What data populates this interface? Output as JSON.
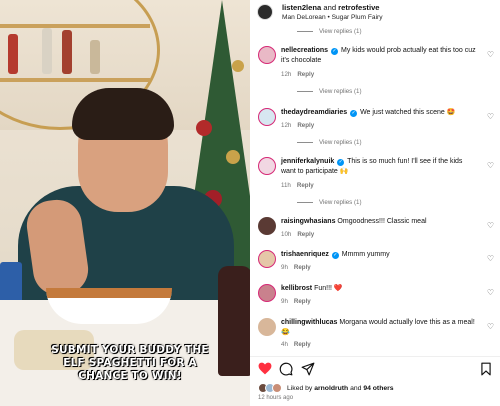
{
  "post": {
    "author_line_user": "listen2lena",
    "author_line_and": " and ",
    "author_line_collab": "retrofestive",
    "audio": "Man DeLorean • Sugar Plum Fairy",
    "caption_overlay": "SUBMIT YOUR BUDDY THE ELF SPAGHETTI FOR A CHANCE TO WIN!"
  },
  "view_replies_label": "View replies (1)",
  "reply_label": "Reply",
  "comments": [
    {
      "user": "nellecreations",
      "verified": true,
      "text": "My kids would prob actually eat this too cuz it's chocolate",
      "time": "12h"
    },
    {
      "user": "thedaydreamdiaries",
      "verified": true,
      "text": "We just watched this scene 🤩",
      "time": "12h"
    },
    {
      "user": "jenniferkalynuik",
      "verified": true,
      "text": "This is so much fun! I'll see if the kids want to participate 🙌",
      "time": "11h"
    },
    {
      "user": "raisingwhasians",
      "verified": false,
      "text": "Omgoodness!!! Classic meal",
      "time": "10h"
    },
    {
      "user": "trishaenriquez",
      "verified": true,
      "text": "Mmmm yummy",
      "time": "9h"
    },
    {
      "user": "kellibrost",
      "verified": false,
      "text": "Fun!!! ❤️",
      "time": "9h"
    },
    {
      "user": "chillingwithlucas",
      "verified": false,
      "text": "Morgana would actually love this as a meal! 😂",
      "time": "4h"
    }
  ],
  "likes": {
    "prefix": "Liked by ",
    "user": "arnoldruth",
    "middle": " and ",
    "others": "94 others"
  },
  "timestamp": "12 hours ago",
  "icons": {
    "like": "heart-filled-icon",
    "comment": "comment-icon",
    "share": "paper-plane-icon",
    "save": "bookmark-icon",
    "comment_like": "heart-outline-icon"
  },
  "colors": {
    "like_red": "#ff3040",
    "verified_blue": "#0095f6",
    "meta_gray": "#737373"
  }
}
